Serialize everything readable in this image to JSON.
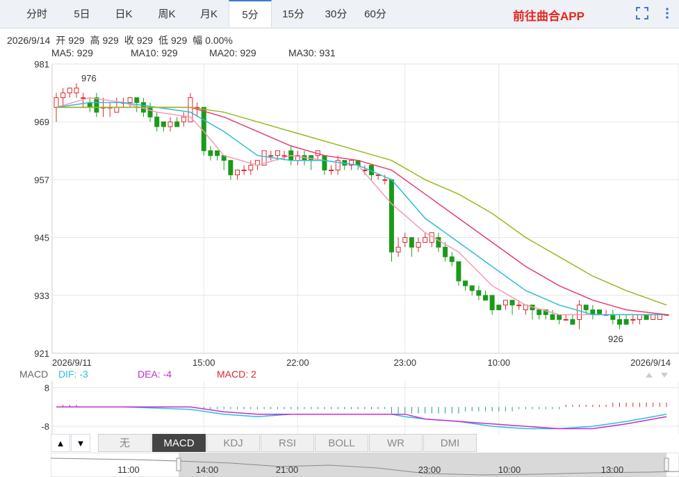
{
  "tabs": [
    {
      "label": "分时",
      "active": false
    },
    {
      "label": "5日",
      "active": false
    },
    {
      "label": "日K",
      "active": false
    },
    {
      "label": "周K",
      "active": false
    },
    {
      "label": "月K",
      "active": false
    },
    {
      "label": "5分",
      "active": true
    },
    {
      "label": "15分",
      "active": false
    },
    {
      "label": "30分",
      "active": false
    },
    {
      "label": "60分",
      "active": false
    }
  ],
  "app_link": "前往曲合APP",
  "info": {
    "date": "2026/9/14",
    "open_label": "开",
    "open": "929",
    "high_label": "高",
    "high": "929",
    "close_label": "收",
    "close": "929",
    "low_label": "低",
    "low": "929",
    "change_label": "幅",
    "change": "0.00%"
  },
  "ma": [
    {
      "label": "MA5: 929",
      "color": "#f29bb4"
    },
    {
      "label": "MA10: 929",
      "color": "#2bbdd6"
    },
    {
      "label": "MA20: 929",
      "color": "#e43d75"
    },
    {
      "label": "MA30: 931",
      "color": "#93bb1e"
    }
  ],
  "macd": {
    "title": "MACD",
    "dif_label": "DIF: -3",
    "dif_color": "#2bbdd6",
    "dea_label": "DEA: -4",
    "dea_color": "#c42bd6",
    "macd_label": "MACD: 2",
    "macd_color": "#d9282e",
    "y_ticks": [
      "8",
      "-8"
    ]
  },
  "indicator_buttons": [
    {
      "label": "无",
      "active": false
    },
    {
      "label": "MACD",
      "active": true
    },
    {
      "label": "KDJ",
      "active": false
    },
    {
      "label": "RSI",
      "active": false
    },
    {
      "label": "BOLL",
      "active": false
    },
    {
      "label": "WR",
      "active": false
    },
    {
      "label": "DMI",
      "active": false
    }
  ],
  "arrows": [
    "▲",
    "▼"
  ],
  "navigator_labels": [
    "11:00",
    "14:00",
    "21:00",
    "23:00",
    "10:00",
    "13:00"
  ],
  "colors": {
    "up": "#d9282e",
    "down": "#1a9a1a",
    "grid": "#e6e6e6"
  },
  "chart_data": {
    "type": "candlestick",
    "title": "",
    "y_ticks": [
      981,
      969,
      957,
      945,
      933,
      921
    ],
    "ylim": [
      921,
      981
    ],
    "x_tick_labels": [
      "2026/9/11",
      "15:00",
      "22:00",
      "23:00",
      "10:00",
      "2026/9/14"
    ],
    "annotations": [
      {
        "label": "976",
        "type": "max"
      },
      {
        "label": "926",
        "type": "min"
      }
    ],
    "candles": [
      [
        972,
        974,
        975,
        969
      ],
      [
        974,
        975,
        976,
        972
      ],
      [
        975,
        976,
        976,
        974
      ],
      [
        975,
        976,
        977,
        974
      ],
      [
        974,
        974,
        975,
        972
      ],
      [
        973,
        972,
        974,
        971
      ],
      [
        974,
        971,
        975,
        970
      ],
      [
        972,
        972,
        974,
        970
      ],
      [
        972,
        972,
        973,
        970
      ],
      [
        971,
        972,
        974,
        971
      ],
      [
        973,
        973,
        974,
        972
      ],
      [
        973,
        974,
        974,
        972
      ],
      [
        974,
        973,
        974,
        971
      ],
      [
        973,
        971,
        974,
        970
      ],
      [
        972,
        970,
        973,
        969
      ],
      [
        970,
        968,
        971,
        967
      ],
      [
        969,
        968,
        969,
        967
      ],
      [
        968,
        969,
        970,
        967
      ],
      [
        969,
        968,
        970,
        968
      ],
      [
        969,
        970,
        971,
        968
      ],
      [
        969,
        974,
        975,
        969
      ],
      [
        972,
        972,
        973,
        970
      ],
      [
        972,
        963,
        972,
        962
      ],
      [
        963,
        962,
        964,
        961
      ],
      [
        963,
        962,
        963,
        961
      ],
      [
        962,
        961,
        962,
        959
      ],
      [
        961,
        958,
        961,
        957
      ],
      [
        958,
        959,
        959,
        957
      ],
      [
        959,
        959,
        960,
        958
      ],
      [
        959,
        960,
        961,
        958
      ],
      [
        960,
        961,
        961,
        959
      ],
      [
        960,
        963,
        963,
        960
      ],
      [
        962,
        962,
        963,
        961
      ],
      [
        962,
        963,
        963,
        961
      ],
      [
        962,
        962,
        963,
        961
      ],
      [
        963,
        961,
        964,
        960
      ],
      [
        961,
        962,
        963,
        960
      ],
      [
        962,
        961,
        963,
        960
      ],
      [
        962,
        961,
        962,
        959
      ],
      [
        962,
        963,
        963,
        961
      ],
      [
        962,
        959,
        962,
        958
      ],
      [
        959,
        959,
        960,
        958
      ],
      [
        959,
        961,
        962,
        958
      ],
      [
        961,
        960,
        961,
        959
      ],
      [
        960,
        961,
        961,
        959
      ],
      [
        961,
        960,
        961,
        959
      ],
      [
        959,
        959,
        960,
        958
      ],
      [
        960,
        958,
        960,
        957
      ],
      [
        958,
        958,
        958,
        957
      ],
      [
        957,
        957,
        958,
        956
      ],
      [
        957,
        942,
        957,
        940
      ],
      [
        942,
        943,
        945,
        941
      ],
      [
        944,
        945,
        946,
        943
      ],
      [
        945,
        943,
        945,
        941
      ],
      [
        943,
        944,
        945,
        942
      ],
      [
        944,
        945,
        946,
        944
      ],
      [
        944,
        946,
        946,
        943
      ],
      [
        945,
        943,
        946,
        942
      ],
      [
        943,
        941,
        944,
        940
      ],
      [
        941,
        940,
        942,
        939
      ],
      [
        940,
        936,
        940,
        935
      ],
      [
        936,
        935,
        936,
        934
      ],
      [
        935,
        934,
        935,
        933
      ],
      [
        934,
        933,
        935,
        932
      ],
      [
        933,
        932,
        934,
        932
      ],
      [
        933,
        930,
        933,
        929
      ],
      [
        931,
        930,
        931,
        930
      ],
      [
        931,
        932,
        932,
        930
      ],
      [
        932,
        931,
        932,
        929
      ],
      [
        931,
        931,
        932,
        930
      ],
      [
        930,
        931,
        931,
        929
      ],
      [
        931,
        930,
        931,
        928
      ],
      [
        930,
        929,
        930,
        928
      ],
      [
        930,
        929,
        930,
        928
      ],
      [
        929,
        928,
        930,
        928
      ],
      [
        929,
        928,
        929,
        927
      ],
      [
        928,
        928,
        929,
        928
      ],
      [
        928,
        927,
        929,
        927
      ],
      [
        928,
        931,
        932,
        926
      ],
      [
        931,
        930,
        931,
        929
      ],
      [
        930,
        929,
        931,
        928
      ],
      [
        930,
        929,
        930,
        929
      ],
      [
        929,
        929,
        930,
        929
      ],
      [
        929,
        928,
        930,
        927
      ],
      [
        928,
        927,
        929,
        926
      ],
      [
        928,
        927,
        929,
        927
      ],
      [
        928,
        928,
        929,
        927
      ],
      [
        928,
        929,
        929,
        927
      ],
      [
        929,
        928,
        929,
        928
      ],
      [
        928,
        929,
        929,
        928
      ],
      [
        928,
        929,
        929,
        928
      ],
      [
        929,
        929,
        929,
        929
      ]
    ],
    "ma_series": [
      {
        "name": "MA5",
        "color": "#f29bb4",
        "points": [
          [
            0,
            972
          ],
          [
            5,
            974
          ],
          [
            10,
            973
          ],
          [
            15,
            971
          ],
          [
            20,
            970
          ],
          [
            22,
            967
          ],
          [
            25,
            962
          ],
          [
            30,
            960
          ],
          [
            35,
            962
          ],
          [
            40,
            961
          ],
          [
            45,
            960
          ],
          [
            50,
            952
          ],
          [
            55,
            946
          ],
          [
            60,
            942
          ],
          [
            65,
            935
          ],
          [
            70,
            931
          ],
          [
            75,
            929
          ],
          [
            80,
            929
          ],
          [
            85,
            929
          ],
          [
            91,
            929
          ]
        ]
      },
      {
        "name": "MA10",
        "color": "#2bbdd6",
        "points": [
          [
            0,
            972
          ],
          [
            5,
            973
          ],
          [
            10,
            973
          ],
          [
            15,
            972
          ],
          [
            20,
            971
          ],
          [
            25,
            967
          ],
          [
            30,
            962
          ],
          [
            35,
            961
          ],
          [
            40,
            961
          ],
          [
            45,
            960
          ],
          [
            50,
            957
          ],
          [
            55,
            949
          ],
          [
            60,
            944
          ],
          [
            65,
            939
          ],
          [
            70,
            934
          ],
          [
            75,
            931
          ],
          [
            80,
            929
          ],
          [
            85,
            929
          ],
          [
            91,
            929
          ]
        ]
      },
      {
        "name": "MA20",
        "color": "#e43d75",
        "points": [
          [
            0,
            972
          ],
          [
            5,
            972
          ],
          [
            10,
            972
          ],
          [
            15,
            972
          ],
          [
            20,
            972
          ],
          [
            25,
            970
          ],
          [
            30,
            967
          ],
          [
            35,
            964
          ],
          [
            40,
            962
          ],
          [
            45,
            961
          ],
          [
            50,
            959
          ],
          [
            55,
            954
          ],
          [
            60,
            949
          ],
          [
            65,
            944
          ],
          [
            70,
            939
          ],
          [
            75,
            935
          ],
          [
            80,
            932
          ],
          [
            85,
            930
          ],
          [
            91,
            929
          ]
        ]
      },
      {
        "name": "MA30",
        "color": "#93bb1e",
        "points": [
          [
            0,
            972
          ],
          [
            10,
            972
          ],
          [
            20,
            972
          ],
          [
            25,
            971
          ],
          [
            30,
            969
          ],
          [
            35,
            967
          ],
          [
            40,
            965
          ],
          [
            45,
            963
          ],
          [
            50,
            961
          ],
          [
            55,
            957
          ],
          [
            60,
            954
          ],
          [
            65,
            950
          ],
          [
            70,
            945
          ],
          [
            75,
            941
          ],
          [
            80,
            937
          ],
          [
            85,
            934
          ],
          [
            91,
            931
          ]
        ]
      }
    ],
    "macd_dif": [
      [
        0,
        0
      ],
      [
        10,
        0
      ],
      [
        20,
        -1
      ],
      [
        25,
        -3
      ],
      [
        30,
        -4
      ],
      [
        35,
        -3
      ],
      [
        40,
        -3
      ],
      [
        45,
        -3
      ],
      [
        50,
        -3
      ],
      [
        52,
        -4
      ],
      [
        55,
        -5
      ],
      [
        60,
        -6
      ],
      [
        65,
        -8
      ],
      [
        70,
        -9
      ],
      [
        75,
        -9
      ],
      [
        80,
        -8
      ],
      [
        85,
        -6
      ],
      [
        91,
        -3
      ]
    ],
    "macd_dea": [
      [
        0,
        0
      ],
      [
        10,
        0
      ],
      [
        20,
        0
      ],
      [
        25,
        -2
      ],
      [
        30,
        -3
      ],
      [
        35,
        -3
      ],
      [
        40,
        -3
      ],
      [
        45,
        -3
      ],
      [
        50,
        -3
      ],
      [
        52,
        -3
      ],
      [
        55,
        -5
      ],
      [
        60,
        -6
      ],
      [
        65,
        -7
      ],
      [
        70,
        -8
      ],
      [
        75,
        -9
      ],
      [
        80,
        -9
      ],
      [
        85,
        -7
      ],
      [
        91,
        -4
      ]
    ],
    "macd_bars": [
      0,
      1,
      1,
      1,
      0,
      0,
      0,
      0,
      0,
      0,
      0,
      0,
      0,
      0,
      0,
      0,
      0,
      0,
      0,
      0,
      0,
      0,
      -1,
      -1,
      -1,
      -1,
      -1,
      -1,
      -1,
      -1,
      -1,
      -1,
      -1,
      -1,
      -1,
      -1,
      -1,
      -1,
      -1,
      -1,
      -1,
      -1,
      -1,
      -1,
      -1,
      -1,
      -1,
      -1,
      -1,
      -1,
      -3,
      -3,
      -3,
      -3,
      -3,
      -3,
      -3,
      -3,
      -3,
      -3,
      -3,
      -2,
      -2,
      -2,
      -2,
      -2,
      -2,
      -2,
      -2,
      -1,
      -1,
      -1,
      -1,
      -1,
      -1,
      -1,
      1,
      1,
      1,
      1,
      1,
      1,
      1,
      2,
      2,
      2,
      2,
      2,
      2,
      2,
      2,
      2
    ]
  }
}
